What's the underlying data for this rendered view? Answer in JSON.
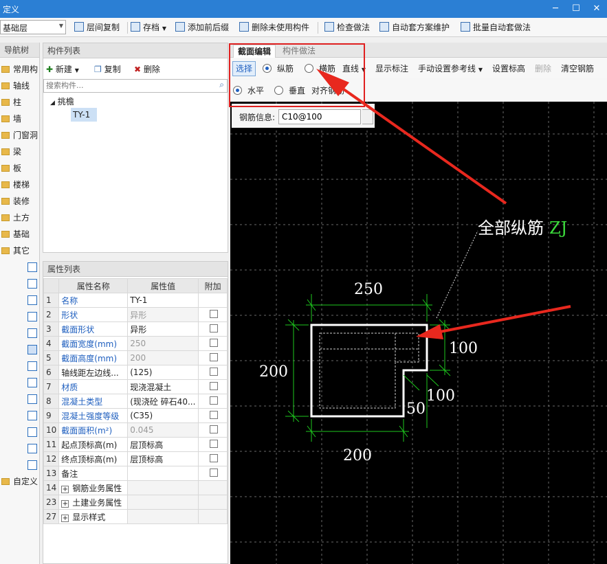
{
  "window": {
    "title": "定义",
    "minimize": "─",
    "maximize": "☐",
    "close": "✕"
  },
  "toolbar": {
    "floor": "基础层",
    "items": [
      "层间复制",
      "存档",
      "添加前后缀",
      "删除未使用构件",
      "检查做法",
      "自动套方案维护",
      "批量自动套做法"
    ]
  },
  "nav": {
    "title": "导航树",
    "items": [
      "常用构",
      "轴线",
      "柱",
      "墙",
      "门窗洞",
      "梁",
      "板",
      "楼梯",
      "装修",
      "土方",
      "基础",
      "其它"
    ],
    "custom": "自定义",
    "sub_icons": [
      "slab-icon",
      "brush-icon",
      "column-icon",
      "cloud-icon",
      "cap-icon",
      "eave-icon",
      "step-icon",
      "stair-icon",
      "roof-icon",
      "rail-icon",
      "pipe-icon",
      "post-icon",
      "ramp-icon"
    ]
  },
  "components": {
    "title": "构件列表",
    "new_label": "新建",
    "copy_label": "复制",
    "delete_label": "删除",
    "search_placeholder": "搜索构件...",
    "tree_parent": "挑檐",
    "tree_child": "TY-1"
  },
  "properties": {
    "title": "属性列表",
    "headers": [
      "",
      "属性名称",
      "属性值",
      "附加"
    ],
    "rows": [
      {
        "num": "1",
        "name": "名称",
        "value": "TY-1"
      },
      {
        "num": "2",
        "name": "形状",
        "value": "异形"
      },
      {
        "num": "3",
        "name": "截面形状",
        "value": "异形"
      },
      {
        "num": "4",
        "name": "截面宽度(mm)",
        "value": "250"
      },
      {
        "num": "5",
        "name": "截面高度(mm)",
        "value": "200"
      },
      {
        "num": "6",
        "name": "轴线距左边线...",
        "value": "(125)"
      },
      {
        "num": "7",
        "name": "材质",
        "value": "现浇混凝土"
      },
      {
        "num": "8",
        "name": "混凝土类型",
        "value": "(现浇砼 碎石40..."
      },
      {
        "num": "9",
        "name": "混凝土强度等级",
        "value": "(C35)"
      },
      {
        "num": "10",
        "name": "截面面积(m²)",
        "value": "0.045"
      },
      {
        "num": "11",
        "name": "起点顶标高(m)",
        "value": "层顶标高"
      },
      {
        "num": "12",
        "name": "终点顶标高(m)",
        "value": "层顶标高"
      },
      {
        "num": "13",
        "name": "备注",
        "value": ""
      },
      {
        "num": "14",
        "name": "钢筋业务属性",
        "value": ""
      },
      {
        "num": "23",
        "name": "土建业务属性",
        "value": ""
      },
      {
        "num": "27",
        "name": "显示样式",
        "value": ""
      }
    ]
  },
  "editor": {
    "tab_active": "截面编辑",
    "tab_other": "构件做法",
    "select_label": "选择",
    "longitudinal": "纵筋",
    "transverse": "横筋",
    "straight_line": "直线",
    "show_dims": "显示标注",
    "manual_ref": "手动设置参考线",
    "set_elev": "设置标高",
    "delete": "删除",
    "clear": "清空钢筋",
    "horizontal": "水平",
    "vertical": "垂直",
    "align_rebar": "对齐钢筋",
    "rebar_info_label": "钢筋信息:",
    "rebar_info_value": "C10@100"
  },
  "drawing": {
    "dim_top": "250",
    "dim_left": "200",
    "dim_right_upper": "100",
    "dim_right_lower": "100",
    "dim_notch": "50",
    "dim_bottom": "200",
    "annotation_text": "全部纵筋",
    "annotation_code": "ZJ",
    "colors": {
      "dim": "#1ec81e",
      "annotation_code": "#3cdc3c",
      "arrow": "#e8281e"
    }
  }
}
